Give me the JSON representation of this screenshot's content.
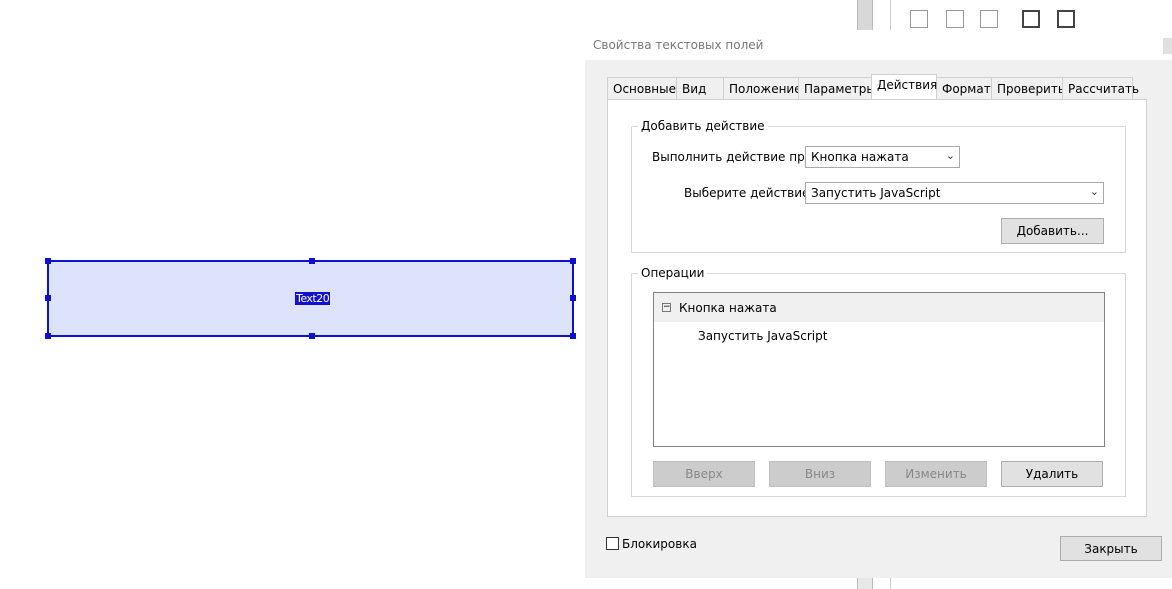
{
  "canvas": {
    "field_name": "Text20"
  },
  "dialog": {
    "title": "Свойства текстовых полей",
    "tabs": [
      "Основные",
      "Вид",
      "Положение",
      "Параметры",
      "Действия",
      "Формат",
      "Проверить",
      "Рассчитать"
    ],
    "active_tab": "Действия",
    "add_action": {
      "group_title": "Добавить действие",
      "trigger_label": "Выполнить действие при:",
      "trigger_value": "Кнопка нажата",
      "action_label": "Выберите действие:",
      "action_value": "Запустить JavaScript",
      "add_button": "Добавить..."
    },
    "operations": {
      "group_title": "Операции",
      "tree": [
        {
          "label": "Кнопка нажата",
          "children": [
            "Запустить JavaScript"
          ]
        }
      ],
      "buttons": {
        "up": "Вверх",
        "down": "Вниз",
        "edit": "Изменить",
        "delete": "Удалить"
      }
    },
    "lock_label": "Блокировка",
    "lock_checked": false,
    "close_button": "Закрыть"
  }
}
